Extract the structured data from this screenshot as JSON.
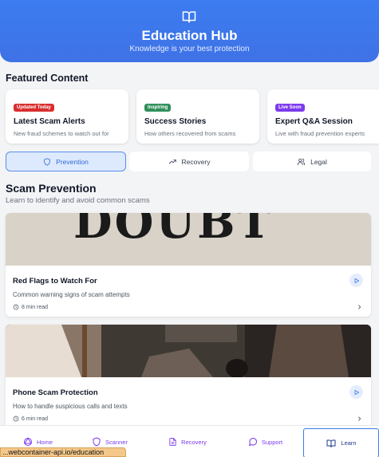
{
  "header": {
    "icon": "book-open-icon",
    "title": "Education Hub",
    "subtitle": "Knowledge is your best protection"
  },
  "featured": {
    "heading": "Featured Content",
    "cards": [
      {
        "badge": "Updated Today",
        "badge_color": "#d92d2d",
        "title": "Latest Scam Alerts",
        "desc": "New fraud schemes to watch out for"
      },
      {
        "badge": "Inspiring",
        "badge_color": "#2f8f5b",
        "title": "Success Stories",
        "desc": "How others recovered from scams"
      },
      {
        "badge": "Live Soon",
        "badge_color": "#7c3aed",
        "title": "Expert Q&A Session",
        "desc": "Live with fraud prevention experts"
      }
    ]
  },
  "tabs": [
    {
      "label": "Prevention",
      "icon": "shield-icon",
      "active": true
    },
    {
      "label": "Recovery",
      "icon": "trending-up-icon",
      "active": false
    },
    {
      "label": "Legal",
      "icon": "users-icon",
      "active": false
    }
  ],
  "prevention": {
    "heading": "Scam Prevention",
    "subtitle": "Learn to identify and avoid common scams"
  },
  "articles": [
    {
      "title": "Red Flags to Watch For",
      "desc": "Common warning signs of scam attempts",
      "meta": "8 min read",
      "image_text": "DOUBT"
    },
    {
      "title": "Phone Scam Protection",
      "desc": "How to handle suspicious calls and texts",
      "meta": "6 min read"
    }
  ],
  "bottom_nav": [
    {
      "label": "Home",
      "icon": "home-icon"
    },
    {
      "label": "Scanner",
      "icon": "shield-icon"
    },
    {
      "label": "Recovery",
      "icon": "file-text-icon"
    },
    {
      "label": "Support",
      "icon": "message-circle-icon"
    },
    {
      "label": "Learn",
      "icon": "book-open-icon",
      "active": true
    }
  ],
  "status_url": "...webcontainer-api.io/education",
  "colors": {
    "primary": "#3b7cf0",
    "nav_text": "#7c3aed",
    "active_tab_bg": "#dde9fd"
  }
}
